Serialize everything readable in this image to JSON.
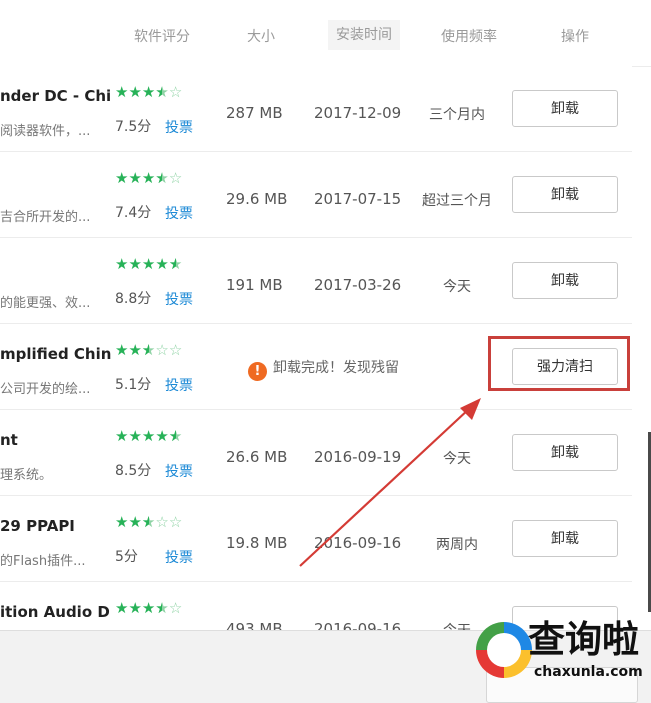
{
  "header": {
    "columns": [
      "软件评分",
      "大小",
      "安装时间",
      "使用频率",
      "操作"
    ]
  },
  "rows": [
    {
      "name": "nder DC - Chi",
      "desc": "阅读器软件，...",
      "score": "7.5分",
      "vote": "投票",
      "size": "287 MB",
      "date": "2017-12-09",
      "freq": "三个月内",
      "action": "卸载"
    },
    {
      "name": "",
      "desc": "吉合所开发的...",
      "score": "7.4分",
      "vote": "投票",
      "size": "29.6 MB",
      "date": "2017-07-15",
      "freq": "超过三个月",
      "action": "卸载"
    },
    {
      "name": "",
      "desc": "的能更强、效...",
      "score": "8.8分",
      "vote": "投票",
      "size": "191 MB",
      "date": "2017-03-26",
      "freq": "今天",
      "action": "卸载"
    },
    {
      "name": "mplified Chin",
      "desc": "公司开发的绘...",
      "score": "5.1分",
      "vote": "投票",
      "notice": "卸载完成！发现残留",
      "action": "强力清扫"
    },
    {
      "name": "nt",
      "desc": "理系统。",
      "score": "8.5分",
      "vote": "投票",
      "size": "26.6 MB",
      "date": "2016-09-19",
      "freq": "今天",
      "action": "卸载"
    },
    {
      "name": "29 PPAPI",
      "desc": "的Flash插件...",
      "score": "5分",
      "vote": "投票",
      "size": "19.8 MB",
      "date": "2016-09-16",
      "freq": "两周内",
      "action": "卸载"
    },
    {
      "name": "ition Audio D",
      "desc": "",
      "score": "",
      "vote": "",
      "size": "493 MB",
      "date": "2016-09-16",
      "freq": "今天",
      "action": ""
    }
  ],
  "ratings": [
    3.5,
    3.5,
    4.5,
    2.5,
    4.5,
    2.5,
    3.5
  ],
  "watermark": {
    "brand": "查询啦",
    "url": "chaxunla.com"
  },
  "colors": {
    "star": "#27b258",
    "link": "#1d8ad6",
    "highlight": "#c9403b",
    "warning": "#ef6a22"
  }
}
